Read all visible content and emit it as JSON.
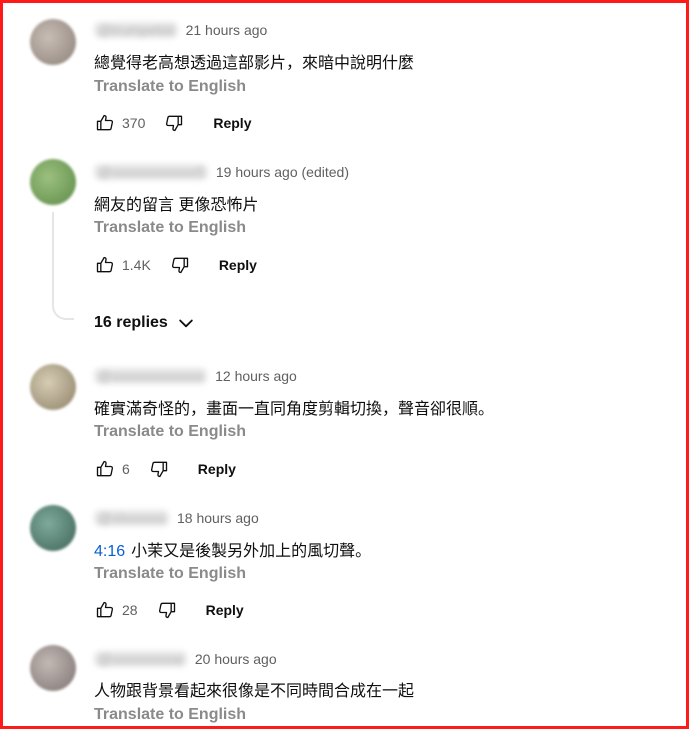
{
  "translate_label": "Translate to English",
  "reply_label": "Reply",
  "comments": [
    {
      "handle": "@trumpetist",
      "time": "21 hours ago",
      "text": "總覺得老高想透過這部影片，來暗中說明什麼",
      "likes": "370",
      "avatar_color": "#9c9089"
    },
    {
      "handle": "@xxxxxxxxxxxx5",
      "time": "19 hours ago (edited)",
      "text": "網友的留言 更像恐怖片",
      "likes": "1.4K",
      "avatar_color": "#6e9a55"
    },
    {
      "handle": "@xxxxxxxxxxxxx",
      "time": "12 hours ago",
      "text": "確實滿奇怪的，畫面一直同角度剪輯切換，聲音卻很順。",
      "likes": "6",
      "avatar_color": "#a79b7e"
    },
    {
      "handle": "@xlxxxxxo",
      "time": "18 hours ago",
      "timestamp_link": "4:16",
      "text": "小茉又是後製另外加上的風切聲。",
      "likes": "28",
      "avatar_color": "#4d7a6c"
    },
    {
      "handle": "@xxxxxxxxxe",
      "time": "20 hours ago",
      "text": "人物跟背景看起來很像是不同時間合成在一起",
      "likes": "",
      "avatar_color": "#8f8886"
    }
  ],
  "replies_toggle": {
    "label": "16 replies"
  }
}
